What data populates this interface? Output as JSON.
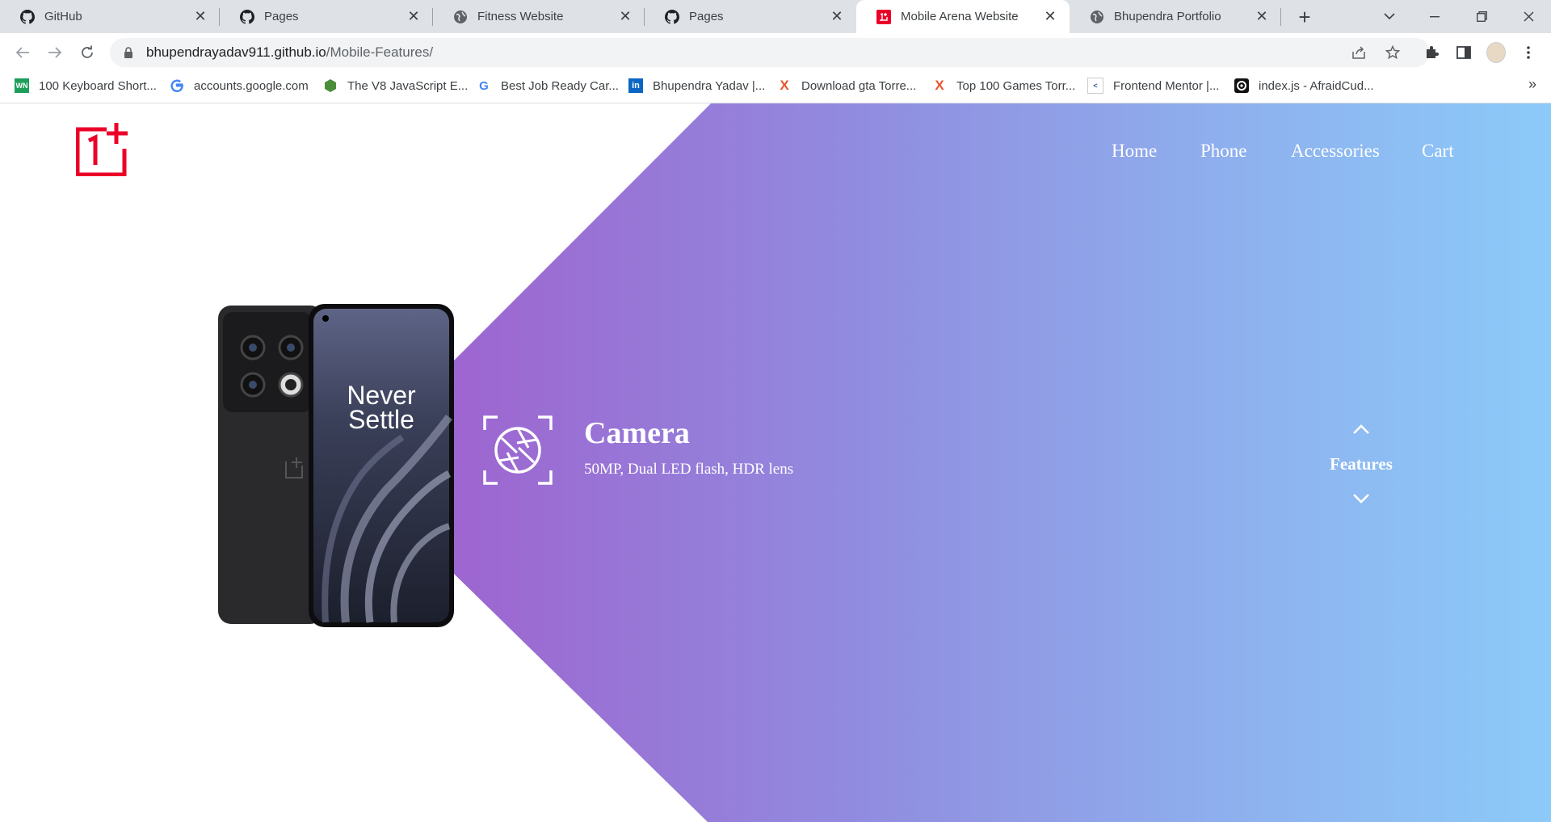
{
  "browser": {
    "tabs": [
      {
        "title": "GitHub",
        "icon": "github-icon",
        "active": false
      },
      {
        "title": "Pages",
        "icon": "github-icon",
        "active": false
      },
      {
        "title": "Fitness Website",
        "icon": "globe-icon",
        "active": false
      },
      {
        "title": "Pages",
        "icon": "github-icon",
        "active": false
      },
      {
        "title": "Mobile Arena Website",
        "icon": "oneplus-favicon",
        "active": true
      },
      {
        "title": "Bhupendra Portfolio",
        "icon": "globe-icon",
        "active": false
      }
    ],
    "url_host": "bhupendrayadav911.github.io",
    "url_path": "/Mobile-Features/",
    "bookmarks": [
      {
        "label": "100 Keyboard Short...",
        "icon": "wn-icon"
      },
      {
        "label": "accounts.google.com",
        "icon": "google-icon"
      },
      {
        "label": "The V8 JavaScript E...",
        "icon": "v8-icon"
      },
      {
        "label": "Best Job Ready Car...",
        "icon": "g-icon"
      },
      {
        "label": "Bhupendra Yadav |...",
        "icon": "linkedin-icon"
      },
      {
        "label": "Download gta Torre...",
        "icon": "x-icon"
      },
      {
        "label": "Top 100 Games Torr...",
        "icon": "x-icon"
      },
      {
        "label": "Frontend Mentor |...",
        "icon": "frontendmentor-icon"
      },
      {
        "label": "index.js - AfraidCud...",
        "icon": "replit-icon"
      }
    ]
  },
  "site": {
    "nav": {
      "home": "Home",
      "phone": "Phone",
      "accessories": "Accessories",
      "cart": "Cart"
    },
    "phone_screen_text_1": "Never",
    "phone_screen_text_2": "Settle",
    "feature": {
      "title": "Camera",
      "description": "50MP, Dual LED flash, HDR lens"
    },
    "features_label": "Features",
    "colors": {
      "brand_red": "#eb0028",
      "gradient_start": "#9a5bcb",
      "gradient_end": "#8ccaf9"
    }
  }
}
